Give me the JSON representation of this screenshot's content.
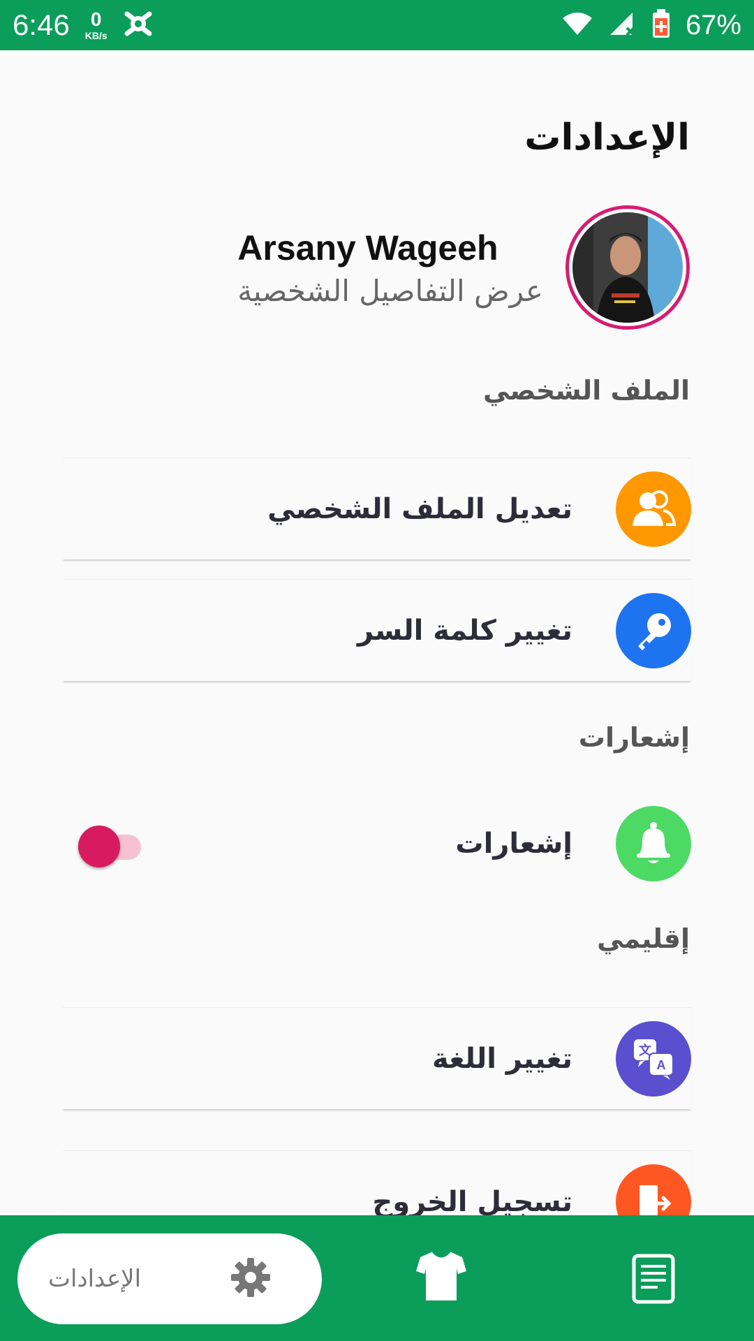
{
  "status_bar": {
    "time": "6:46",
    "net_speed_value": "0",
    "net_speed_unit": "KB/s",
    "battery_percent": "67%"
  },
  "page": {
    "title": "الإعدادات"
  },
  "profile": {
    "name": "Arsany Wageeh",
    "view_details": "عرض التفاصيل الشخصية"
  },
  "sections": {
    "profile_header": "الملف الشخصي",
    "notifications_header": "إشعارات",
    "regional_header": "إقليمي"
  },
  "rows": {
    "edit_profile": "تعديل الملف الشخصي",
    "change_password": "تغيير كلمة السر",
    "notifications": "إشعارات",
    "change_language": "تغيير اللغة",
    "logout": "تسجيل الخروج"
  },
  "toggles": {
    "notifications_enabled": false
  },
  "bottom_nav": {
    "settings_label": "الإعدادات"
  },
  "colors": {
    "brand_green": "#0b9d5a",
    "accent_pink": "#d81b60",
    "edit_profile_icon": "#ff9800",
    "password_icon": "#1e74f0",
    "notifications_icon": "#4cd964",
    "language_icon": "#5a4fcf",
    "logout_icon": "#ff5722"
  },
  "icons": {
    "edit_profile": "users-icon",
    "change_password": "key-icon",
    "notifications": "bell-icon",
    "change_language": "translate-icon",
    "logout": "exit-door-icon",
    "nav_settings": "gear-icon",
    "nav_team": "jersey-icon",
    "nav_news": "news-icon"
  }
}
